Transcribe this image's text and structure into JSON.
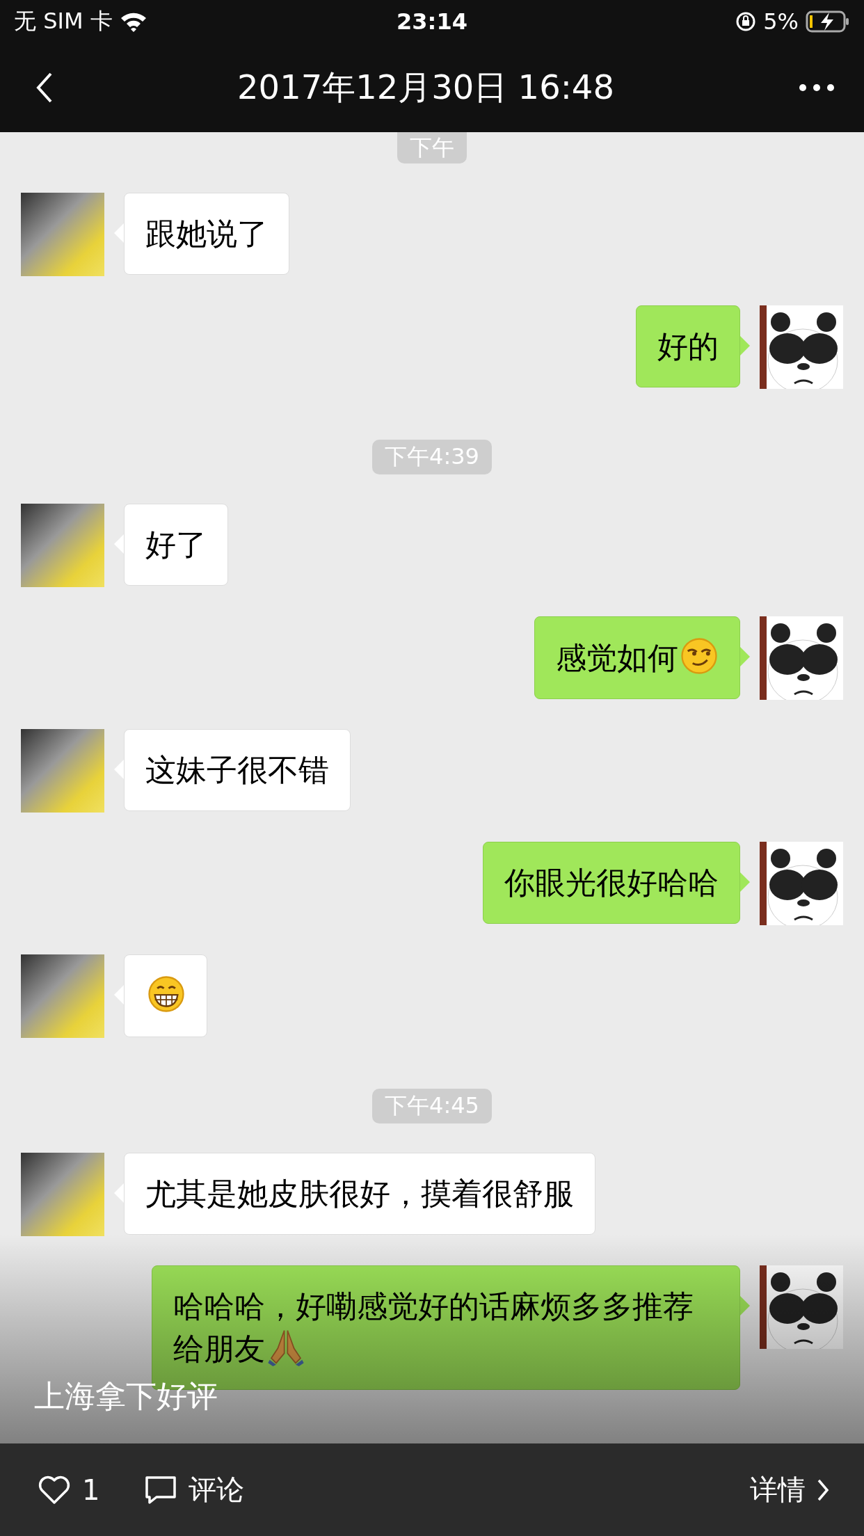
{
  "status_bar": {
    "carrier": "无 SIM 卡",
    "time": "23:14",
    "battery": "5%"
  },
  "nav": {
    "title": "2017年12月30日 16:48"
  },
  "chat": [
    {
      "kind": "time",
      "text": "下午"
    },
    {
      "kind": "received",
      "parts": [
        {
          "kind": "text",
          "text": "跟她说了"
        }
      ]
    },
    {
      "kind": "sent",
      "parts": [
        {
          "kind": "text",
          "text": "好的"
        }
      ]
    },
    {
      "kind": "time",
      "text": "下午4:39"
    },
    {
      "kind": "received",
      "parts": [
        {
          "kind": "text",
          "text": "好了"
        }
      ]
    },
    {
      "kind": "sent",
      "parts": [
        {
          "kind": "text",
          "text": "感觉如何"
        },
        {
          "kind": "smirk"
        }
      ]
    },
    {
      "kind": "received",
      "parts": [
        {
          "kind": "text",
          "text": "这妹子很不错"
        }
      ]
    },
    {
      "kind": "sent",
      "parts": [
        {
          "kind": "text",
          "text": "你眼光很好哈哈"
        }
      ]
    },
    {
      "kind": "received",
      "parts": [
        {
          "kind": "grin"
        }
      ]
    },
    {
      "kind": "time",
      "text": "下午4:45"
    },
    {
      "kind": "received",
      "parts": [
        {
          "kind": "text",
          "text": "尤其是她皮肤很好，摸着很舒服"
        }
      ]
    },
    {
      "kind": "sent",
      "parts": [
        {
          "kind": "text",
          "text": "哈哈哈，好嘞感觉好的话麻烦多多推荐给朋友"
        },
        {
          "kind": "pray"
        }
      ]
    }
  ],
  "caption": "上海拿下好评",
  "footer": {
    "likes": "1",
    "comment": "评论",
    "details": "详情"
  }
}
